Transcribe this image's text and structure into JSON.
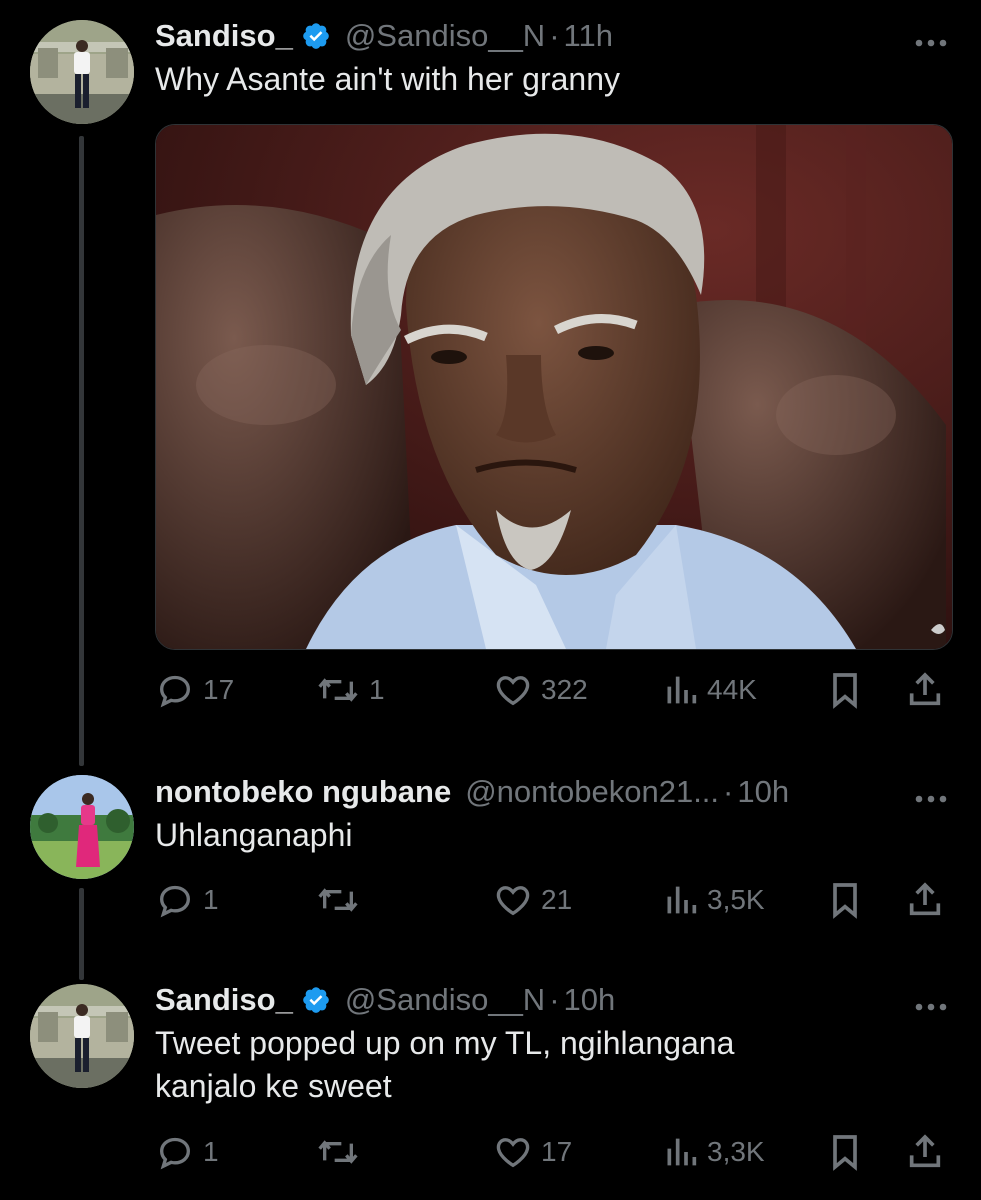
{
  "tweets": [
    {
      "display_name": "Sandiso_",
      "verified": true,
      "handle": "@Sandiso__N",
      "separator": "·",
      "time": "11h",
      "text_lines": [
        "Why Asante ain't with her granny"
      ],
      "has_media": true,
      "media_icon": "photo-elderly-man-leather-chair",
      "stats": {
        "replies": "17",
        "reposts": "1",
        "likes": "322",
        "views": "44K"
      }
    },
    {
      "display_name": "nontobeko ngubane",
      "verified": false,
      "handle": "@nontobekon21...",
      "separator": "·",
      "time": "10h",
      "text_lines": [
        "Uhlanganaphi"
      ],
      "has_media": false,
      "stats": {
        "replies": "1",
        "reposts": "",
        "likes": "21",
        "views": "3,5K"
      }
    },
    {
      "display_name": "Sandiso_",
      "verified": true,
      "handle": "@Sandiso__N",
      "separator": "·",
      "time": "10h",
      "text_lines": [
        "Tweet popped up on my TL, ngihlangana",
        "kanjalo ke sweet"
      ],
      "has_media": false,
      "stats": {
        "replies": "1",
        "reposts": "",
        "likes": "17",
        "views": "3,3K"
      }
    }
  ],
  "icons": {
    "verified": "verified-badge-icon",
    "more": "more-dots-icon",
    "reply": "reply-bubble-icon",
    "repost": "repost-icon",
    "like": "heart-icon",
    "views": "views-bars-icon",
    "bookmark": "bookmark-icon",
    "share": "share-icon"
  },
  "colors": {
    "background": "#000000",
    "text_primary": "#e7e9ea",
    "text_secondary": "#71767b",
    "verified": "#1d9bf0",
    "thread_line": "#333639"
  }
}
